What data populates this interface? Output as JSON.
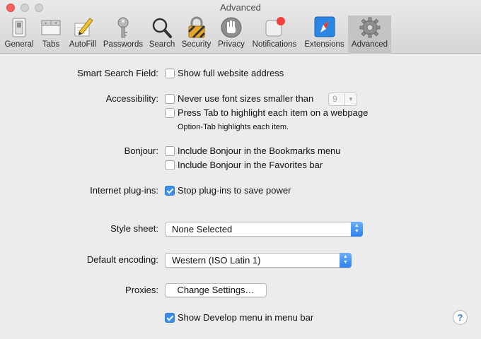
{
  "window": {
    "title": "Advanced"
  },
  "toolbar": {
    "tabs": [
      {
        "label": "General",
        "icon": "general-switch-icon"
      },
      {
        "label": "Tabs",
        "icon": "tabs-icon"
      },
      {
        "label": "AutoFill",
        "icon": "autofill-pencil-icon"
      },
      {
        "label": "Passwords",
        "icon": "key-icon"
      },
      {
        "label": "Search",
        "icon": "magnifier-icon"
      },
      {
        "label": "Security",
        "icon": "padlock-icon"
      },
      {
        "label": "Privacy",
        "icon": "hand-icon"
      },
      {
        "label": "Notifications",
        "icon": "notification-badge-icon"
      },
      {
        "label": "Extensions",
        "icon": "extensions-compass-icon"
      },
      {
        "label": "Advanced",
        "icon": "gear-icon",
        "active": true
      }
    ]
  },
  "settings": {
    "smart_search": {
      "label": "Smart Search Field:",
      "option": "Show full website address",
      "checked": false
    },
    "accessibility": {
      "label": "Accessibility:",
      "font_option": "Never use font sizes smaller than",
      "font_option_checked": false,
      "font_size_value": "9",
      "tab_option": "Press Tab to highlight each item on a webpage",
      "tab_option_checked": false,
      "note": "Option-Tab highlights each item."
    },
    "bonjour": {
      "label": "Bonjour:",
      "bookmarks_option": "Include Bonjour in the Bookmarks menu",
      "bookmarks_checked": false,
      "favorites_option": "Include Bonjour in the Favorites bar",
      "favorites_checked": false
    },
    "plugins": {
      "label": "Internet plug-ins:",
      "option": "Stop plug-ins to save power",
      "checked": true
    },
    "style_sheet": {
      "label": "Style sheet:",
      "value": "None Selected"
    },
    "encoding": {
      "label": "Default encoding:",
      "value": "Western (ISO Latin 1)"
    },
    "proxies": {
      "label": "Proxies:",
      "button": "Change Settings…"
    },
    "develop": {
      "option": "Show Develop menu in menu bar",
      "checked": true
    }
  },
  "help": {
    "label": "?"
  },
  "colors": {
    "accent": "#3b8ef0",
    "close": "#fc605c",
    "active_tab": "#c4c4c4"
  }
}
